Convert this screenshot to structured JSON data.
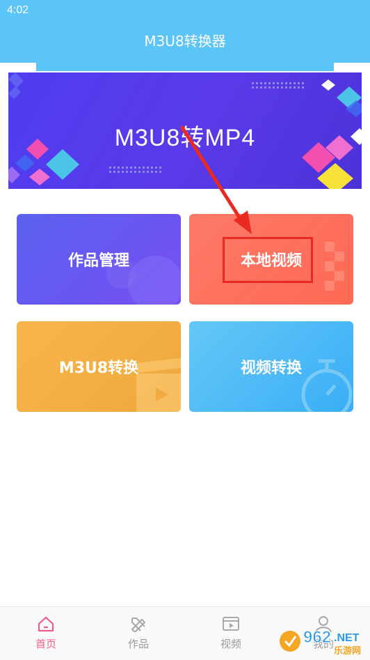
{
  "status_bar": {
    "time": "4:02"
  },
  "app": {
    "title": "M3U8转换器"
  },
  "banner": {
    "title": "M3U8转MP4"
  },
  "cards": [
    {
      "label": "作品管理"
    },
    {
      "label": "本地视频"
    },
    {
      "label": "M3U8转换"
    },
    {
      "label": "视频转换"
    }
  ],
  "nav": {
    "items": [
      {
        "label": "首页",
        "icon": "home-icon",
        "active": true
      },
      {
        "label": "作品",
        "icon": "works-icon",
        "active": false
      },
      {
        "label": "视频",
        "icon": "video-icon",
        "active": false
      },
      {
        "label": "我的",
        "icon": "user-icon",
        "active": false
      }
    ]
  },
  "watermark": {
    "site_a": "962",
    "site_b": ".NET",
    "caption": "乐游网"
  },
  "colors": {
    "header": "#5cc5f8",
    "banner": "#5a39e8",
    "active_nav": "#f06088",
    "highlight": "#e82a20"
  }
}
